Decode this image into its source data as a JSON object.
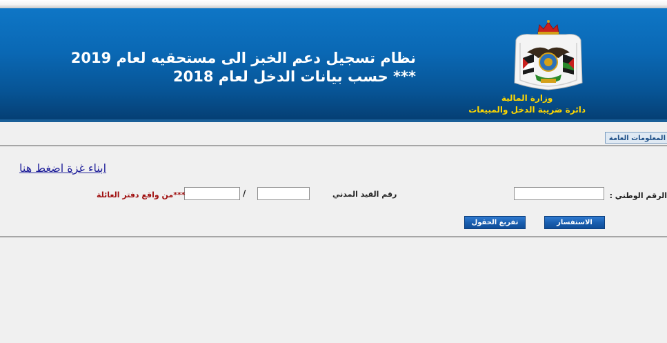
{
  "header": {
    "title_line1": "نظام تسجيل دعم الخبز الى مستحقيه لعام 2019",
    "title_line2": "***  حسب بيانات الدخل لعام 2018",
    "ministry_name": "وزارة المالية",
    "department_name": "دائرة ضريبة الدخل والمبيعات",
    "emblem_icon": "jordan-coat-of-arms-icon",
    "banner_color": "#0a68b4",
    "ministry_text_color": "#ffd700"
  },
  "tab": {
    "general_info": "المعلومات العامة"
  },
  "gaza_link": "ابناء غزة اضغط هنا",
  "form": {
    "national_id_label": "الرقم الوطني :",
    "national_id_value": "",
    "civil_record_label": "رقم القيد المدني",
    "civil_record_part1": "",
    "civil_record_part2": "",
    "slash": "/",
    "family_book_note": "***من واقع دفتر العائلة",
    "note_color": "#a01010"
  },
  "buttons": {
    "inquiry": "الاستفسار",
    "clear_fields": "تفريغ الحقول",
    "button_color": "#1a5fb0"
  }
}
